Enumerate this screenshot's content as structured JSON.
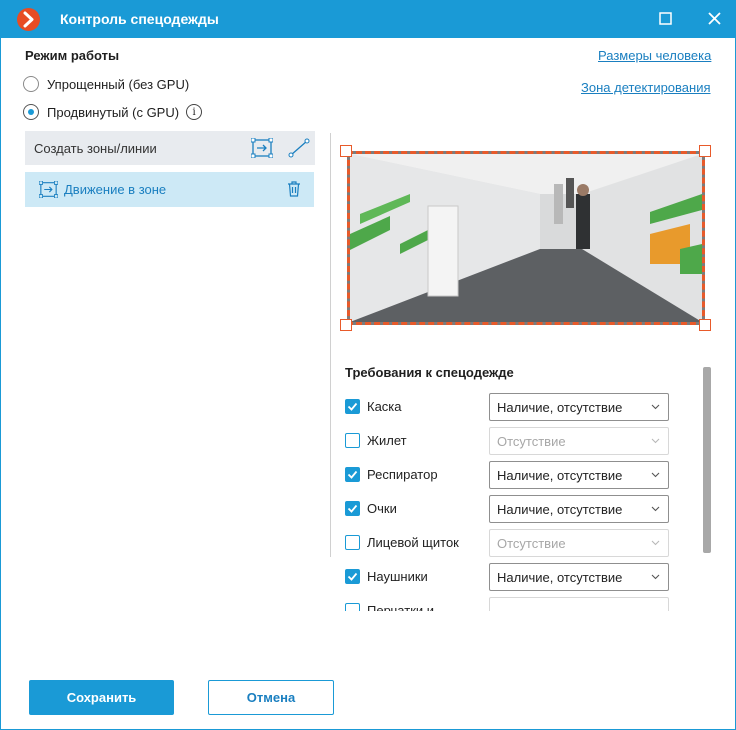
{
  "window": {
    "title": "Контроль спецодежды",
    "accent_color": "#1a9ad6",
    "logo_color": "#e74c24"
  },
  "mode": {
    "title": "Режим работы",
    "options": [
      {
        "label": "Упрощенный (без GPU)",
        "selected": false
      },
      {
        "label": "Продвинутый (с GPU)",
        "selected": true
      }
    ],
    "info_icon": "info-icon"
  },
  "links": {
    "person_size": "Размеры человека",
    "detection_zone": "Зона детектирования"
  },
  "zones": {
    "create_label": "Создать зоны/линии",
    "create_zone_icon": "zone-rect-icon",
    "create_line_icon": "line-icon",
    "items": [
      {
        "label": "Движение в зоне",
        "icon": "zone-rect-icon",
        "delete_icon": "trash-icon"
      }
    ]
  },
  "preview": {
    "description_icon": "camera-preview",
    "zone_border_color": "#e85a2a"
  },
  "requirements": {
    "title": "Требования к спецодежде",
    "items": [
      {
        "label": "Каска",
        "checked": true,
        "value": "Наличие, отсутствие"
      },
      {
        "label": "Жилет",
        "checked": false,
        "value": "Отсутствие"
      },
      {
        "label": "Респиратор",
        "checked": true,
        "value": "Наличие, отсутствие"
      },
      {
        "label": "Очки",
        "checked": true,
        "value": "Наличие, отсутствие"
      },
      {
        "label": "Лицевой щиток",
        "checked": false,
        "value": "Отсутствие"
      },
      {
        "label": "Наушники",
        "checked": true,
        "value": "Наличие, отсутствие"
      },
      {
        "label": "Перчатки и",
        "checked": false,
        "value": ""
      }
    ]
  },
  "buttons": {
    "save": "Сохранить",
    "cancel": "Отмена"
  }
}
